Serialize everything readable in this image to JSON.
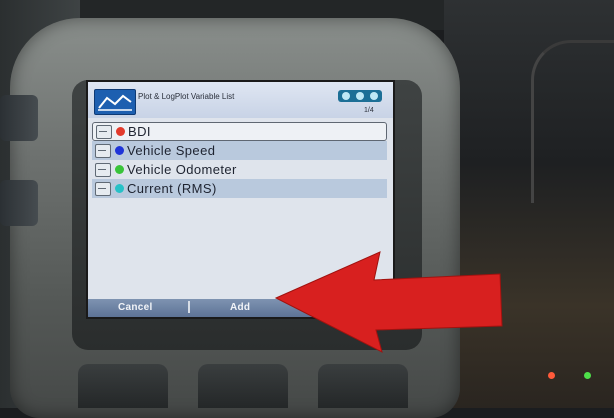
{
  "screen": {
    "title": "Plot & LogPlot Variable List",
    "page_indicator": "1/4",
    "items": [
      {
        "label": "BDI",
        "dot_color": "#e23a2c",
        "selected": true
      },
      {
        "label": "Vehicle Speed",
        "dot_color": "#1f34d8",
        "selected": false
      },
      {
        "label": "Vehicle Odometer",
        "dot_color": "#39c43a",
        "selected": false
      },
      {
        "label": "Current (RMS)",
        "dot_color": "#27c1c7",
        "selected": false
      }
    ],
    "softkeys": {
      "cancel": "Cancel",
      "add": "Add"
    }
  },
  "icons": {
    "app": "plot-icon",
    "status": "connection-status-icon",
    "row": "variable-plot-icon",
    "annotation": "red-arrow-pointer"
  },
  "colors": {
    "softbar": "#6a80a3",
    "arrow": "#d8201f",
    "selected_row": "#eef1f5"
  }
}
